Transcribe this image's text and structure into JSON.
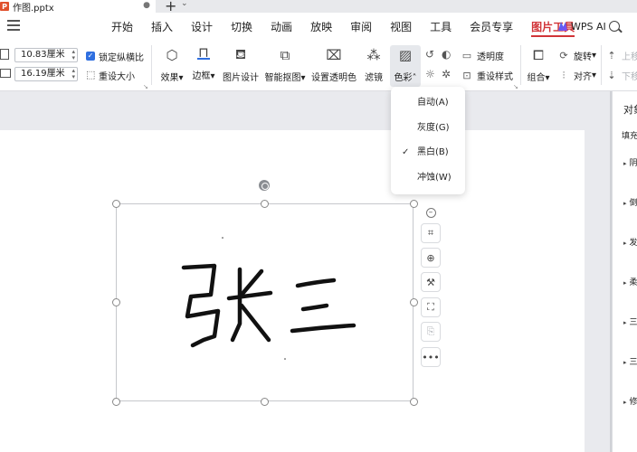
{
  "titlebar": {
    "doc_name": "作图.pptx",
    "app_icon": "P",
    "modified_dot": "●",
    "new_tab": "+",
    "more": "⌄"
  },
  "menu": {
    "tabs": [
      "开始",
      "插入",
      "设计",
      "切换",
      "动画",
      "放映",
      "审阅",
      "视图",
      "工具",
      "会员专享",
      "图片工具"
    ],
    "active_tab": "图片工具",
    "wps_ai": "WPS AI",
    "accent": "#d13438"
  },
  "ribbon": {
    "width_value": "10.83厘米",
    "height_value": "16.19厘米",
    "lock_ratio": "锁定纵横比",
    "reset_size": "重设大小",
    "effects": "效果",
    "border": "边框",
    "picture_design": "图片设计",
    "smart_cutout": "智能抠图",
    "set_transparent": "设置透明色",
    "filter": "滤镜",
    "color": "色彩",
    "transparency": "透明度",
    "reset_style": "重设样式",
    "group": "组合",
    "rotate": "旋转",
    "align": "对齐",
    "move_up": "上移",
    "move_down": "下移"
  },
  "color_menu": {
    "items": [
      {
        "label": "自动(A)",
        "checked": false
      },
      {
        "label": "灰度(G)",
        "checked": false
      },
      {
        "label": "黑白(B)",
        "checked": true
      },
      {
        "label": "冲蚀(W)",
        "checked": false
      }
    ],
    "checkmark": "✓"
  },
  "right_panel": {
    "title": "对象属性",
    "subtitle": "填充与线条",
    "sections": [
      "阴影",
      "倒影",
      "发光",
      "柔化边缘",
      "三维格式",
      "三维旋转",
      "修改"
    ]
  },
  "picture": {
    "content": "张三"
  },
  "side_toolbar": [
    "minus-icon",
    "crop-icon",
    "zoom-icon",
    "magic-icon",
    "cutout-icon",
    "ocr-icon",
    "more-icon"
  ]
}
